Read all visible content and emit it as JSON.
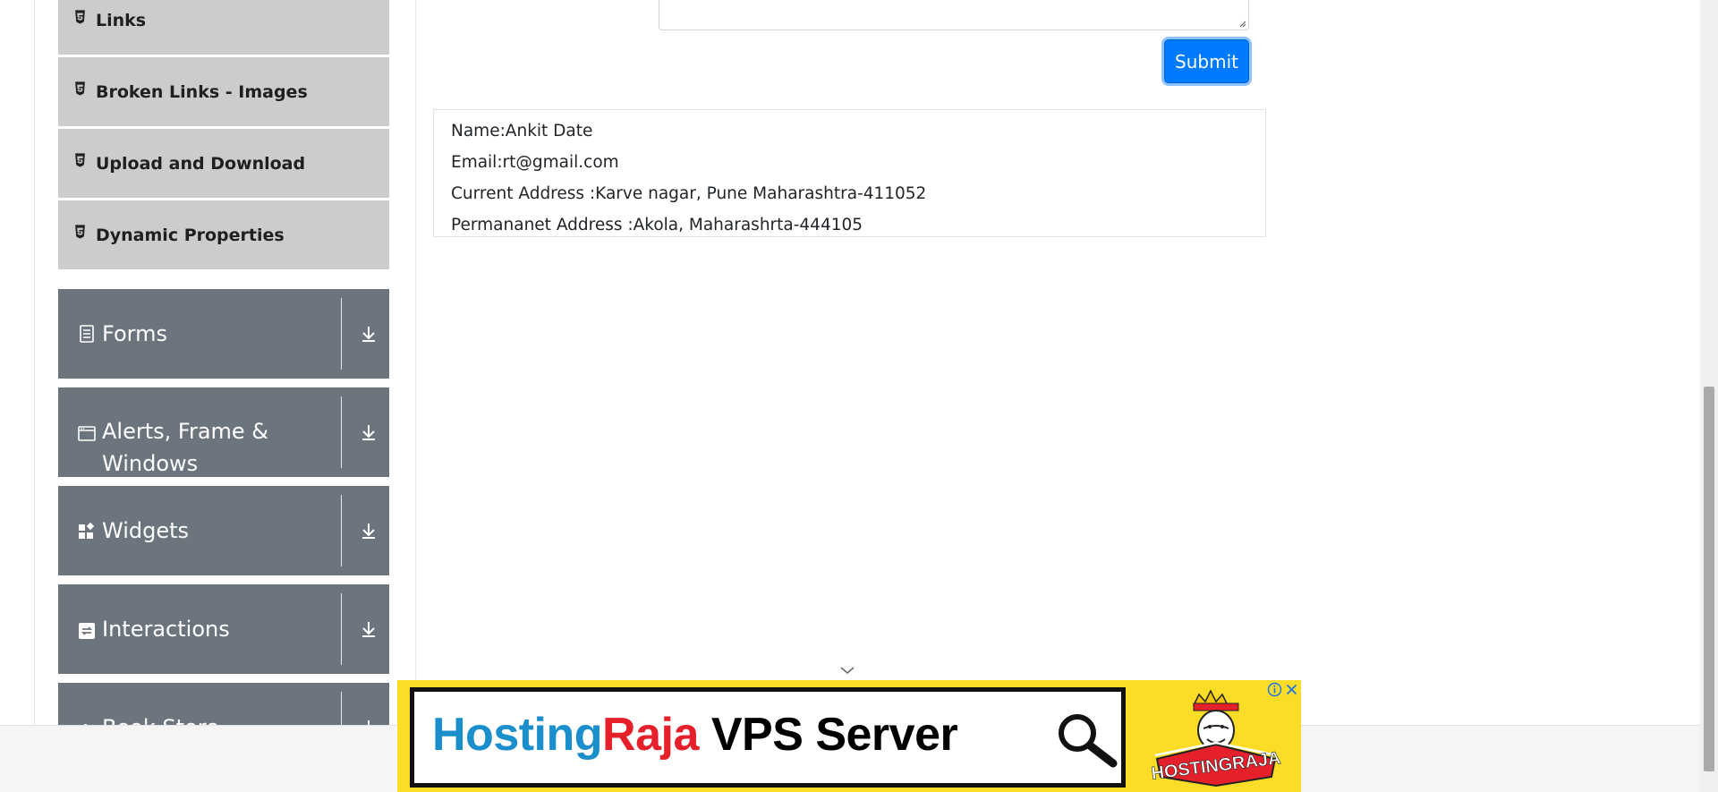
{
  "sidebar": {
    "submenu_items": [
      {
        "label": "Links",
        "icon": "html5-icon"
      },
      {
        "label": "Broken Links - Images",
        "icon": "html5-icon"
      },
      {
        "label": "Upload and Download",
        "icon": "html5-icon"
      },
      {
        "label": "Dynamic Properties",
        "icon": "html5-icon"
      }
    ],
    "groups": [
      {
        "label": "Forms",
        "icon": "form-list-icon"
      },
      {
        "label": "Alerts, Frame & Windows",
        "icon": "browser-window-icon"
      },
      {
        "label": "Widgets",
        "icon": "widgets-icon"
      },
      {
        "label": "Interactions",
        "icon": "interactions-icon"
      },
      {
        "label": "Book Store Application",
        "icon": "book-store-icon"
      }
    ]
  },
  "form": {
    "submit_label": "Submit"
  },
  "output": {
    "name": "Name:Ankit Date",
    "email": "Email:rt@gmail.com",
    "current_address": "Current Address :Karve nagar, Pune Maharashtra-411052",
    "permanent_address": "Permananet Address :Akola, Maharashrta-444105"
  },
  "ad": {
    "brand_part1": "Hosting",
    "brand_part2": "Raja",
    "tagline": " VPS Server",
    "logo_text": "HOSTINGRAJA",
    "colors": {
      "background": "#fbdd28",
      "blue": "#1a8fcc",
      "red": "#e5202a"
    }
  },
  "colors": {
    "submenu_bg": "#cccccc",
    "group_bg": "#6c757d",
    "primary": "#007bff"
  }
}
